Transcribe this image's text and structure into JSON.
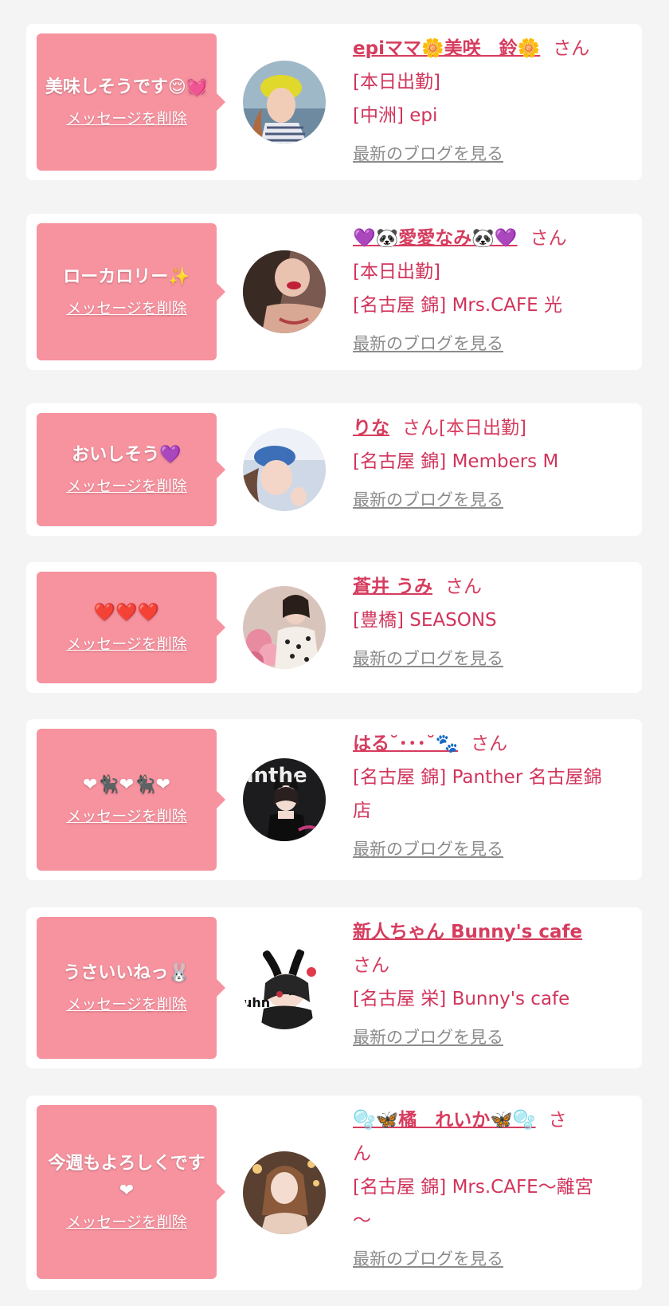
{
  "accent_color": "#d63c5e",
  "bubble_color": "#f7929f",
  "delete_label": "メッセージを削除",
  "blog_label": "最新のブログを見る",
  "entries": [
    {
      "message": "美味しそうです😌💓",
      "name": "epiママ🌼美咲　鈴🌼",
      "suffix": "さん",
      "lines": [
        "[本日出勤]",
        "[中洲] epi"
      ],
      "avatar_color": "#c8b48a"
    },
    {
      "message": "ローカロリー✨",
      "name": "💜🐼愛愛なみ🐼💜",
      "suffix": "さん",
      "lines": [
        "[本日出勤]",
        "[名古屋 錦] Mrs.CAFE 光"
      ],
      "avatar_color": "#8a6b5c"
    },
    {
      "message": "おいしそう💜",
      "name": "りな",
      "suffix": "さん[本日出勤]",
      "lines": [
        "[名古屋 錦] Members M"
      ],
      "avatar_color": "#9fb2cf"
    },
    {
      "message": "❤️❤️❤️",
      "name": "蒼井 うみ",
      "suffix": "さん",
      "lines": [
        "[豊橋] SEASONS"
      ],
      "avatar_color": "#d8b6b2"
    },
    {
      "message": "❤🐈‍⬛❤🐈‍⬛❤",
      "name": "はる˘･･･˘🐾",
      "suffix": "さん",
      "lines": [
        "[名古屋 錦] Panther 名古屋錦",
        "店"
      ],
      "avatar_color": "#2a2a2a"
    },
    {
      "message": "うさいいねっ🐰",
      "name": "新人ちゃん Bunny's cafe",
      "suffix": "さん",
      "lines": [
        "[名古屋 栄] Bunny's cafe"
      ],
      "avatar_color": "#3a3a3a"
    },
    {
      "message": "今週もよろしくです❤",
      "name": "🫧🦋橘　れいか🦋🫧",
      "suffix": "さ",
      "lines": [
        "ん",
        "[名古屋 錦] Mrs.CAFE〜離宮",
        "〜"
      ],
      "avatar_color": "#a88466"
    }
  ]
}
